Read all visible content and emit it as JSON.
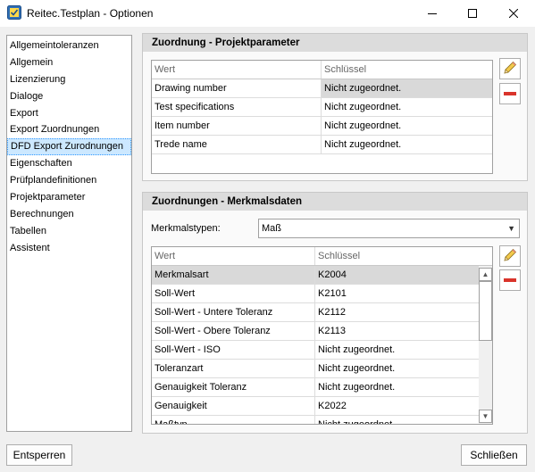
{
  "window": {
    "title": "Reitec.Testplan - Optionen"
  },
  "nav": {
    "items": [
      "Allgemeintoleranzen",
      "Allgemein",
      "Lizenzierung",
      "Dialoge",
      "Export",
      "Export Zuordnungen",
      "DFD Export Zurodnungen",
      "Eigenschaften",
      "Prüfplandefinitionen",
      "Projektparameter",
      "Berechnungen",
      "Tabellen",
      "Assistent"
    ],
    "selected": "DFD Export Zurodnungen"
  },
  "projekt": {
    "title": "Zuordnung - Projektparameter",
    "columns": [
      "Wert",
      "Schlüssel"
    ],
    "rows": [
      [
        "Drawing number",
        "Nicht zugeordnet."
      ],
      [
        "Test specifications",
        "Nicht zugeordnet."
      ],
      [
        "Item number",
        "Nicht zugeordnet."
      ],
      [
        "Trede name",
        "Nicht zugeordnet."
      ]
    ]
  },
  "merkmal": {
    "title": "Zuordnungen - Merkmalsdaten",
    "type_label": "Merkmalstypen:",
    "type_value": "Maß",
    "columns": [
      "Wert",
      "Schlüssel"
    ],
    "rows": [
      [
        "Merkmalsart",
        "K2004"
      ],
      [
        "Soll-Wert",
        "K2101"
      ],
      [
        "Soll-Wert - Untere Toleranz",
        "K2112"
      ],
      [
        "Soll-Wert - Obere Toleranz",
        "K2113"
      ],
      [
        "Soll-Wert - ISO",
        "Nicht zugeordnet."
      ],
      [
        "Toleranzart",
        "Nicht zugeordnet."
      ],
      [
        "Genauigkeit Toleranz",
        "Nicht zugeordnet."
      ],
      [
        "Genauigkeit",
        "K2022"
      ],
      [
        "Maßtyp",
        "Nicht zugeordnet."
      ]
    ]
  },
  "buttons": {
    "unlock": "Entsperren",
    "close": "Schließen"
  },
  "icons": {
    "edit": "pencil-icon",
    "remove": "minus-icon"
  },
  "colors": {
    "selection": "#cce8ff",
    "remove": "#d9342b",
    "highlight_row": "#d9d9d9"
  }
}
